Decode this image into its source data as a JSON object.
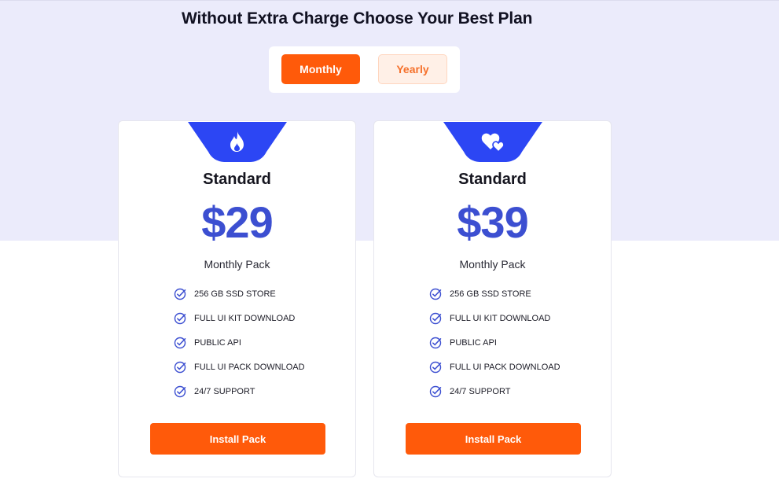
{
  "header": {
    "title": "Without Extra Charge Choose Your Best Plan"
  },
  "billing_toggle": {
    "monthly_label": "Monthly",
    "yearly_label": "Yearly",
    "selected": "Monthly"
  },
  "colors": {
    "accent": "#ff5a0a",
    "price": "#3c4fd1",
    "badge": "#2c46f4",
    "hero_bg": "#ebebfb"
  },
  "plans": [
    {
      "icon": "flame-icon",
      "name": "Standard",
      "price": "$29",
      "period": "Monthly Pack",
      "features": [
        "256 GB SSD STORE",
        "FULL UI KIT DOWNLOAD",
        "PUBLIC API",
        "FULL UI PACK DOWNLOAD",
        "24/7 SUPPORT"
      ],
      "button_label": "Install Pack"
    },
    {
      "icon": "hearts-icon",
      "name": "Standard",
      "price": "$39",
      "period": "Monthly Pack",
      "features": [
        "256 GB SSD STORE",
        "FULL UI KIT DOWNLOAD",
        "PUBLIC API",
        "FULL UI PACK DOWNLOAD",
        "24/7 SUPPORT"
      ],
      "button_label": "Install Pack"
    }
  ]
}
